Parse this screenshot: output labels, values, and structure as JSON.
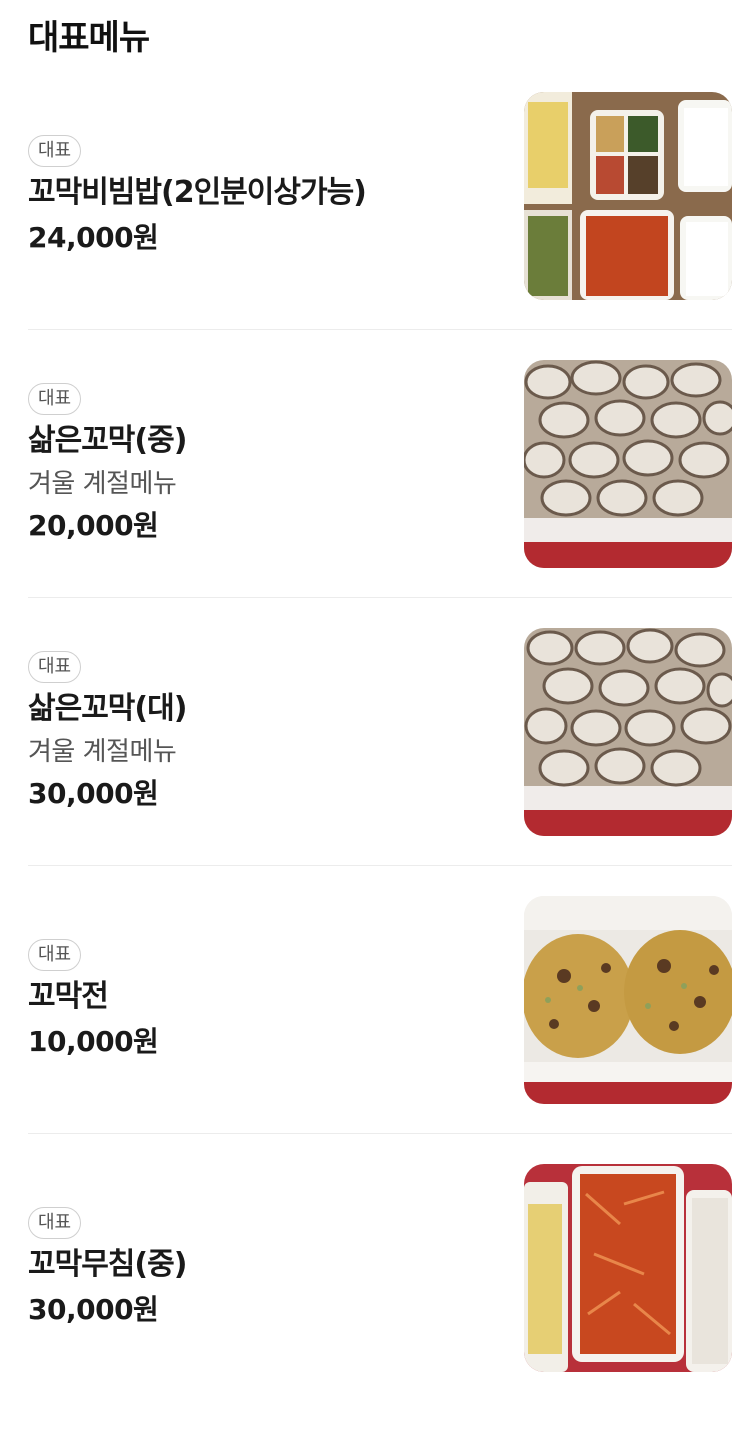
{
  "section": {
    "title": "대표메뉴"
  },
  "menu": {
    "items": [
      {
        "badge": "대표",
        "name": "꼬막비빔밥(2인분이상가능)",
        "desc": "",
        "price": "24,000원"
      },
      {
        "badge": "대표",
        "name": "삶은꼬막(중)",
        "desc": "겨울 계절메뉴",
        "price": "20,000원"
      },
      {
        "badge": "대표",
        "name": "삶은꼬막(대)",
        "desc": "겨울 계절메뉴",
        "price": "30,000원"
      },
      {
        "badge": "대표",
        "name": "꼬막전",
        "desc": "",
        "price": "10,000원"
      },
      {
        "badge": "대표",
        "name": "꼬막무침(중)",
        "desc": "",
        "price": "30,000원"
      }
    ]
  }
}
